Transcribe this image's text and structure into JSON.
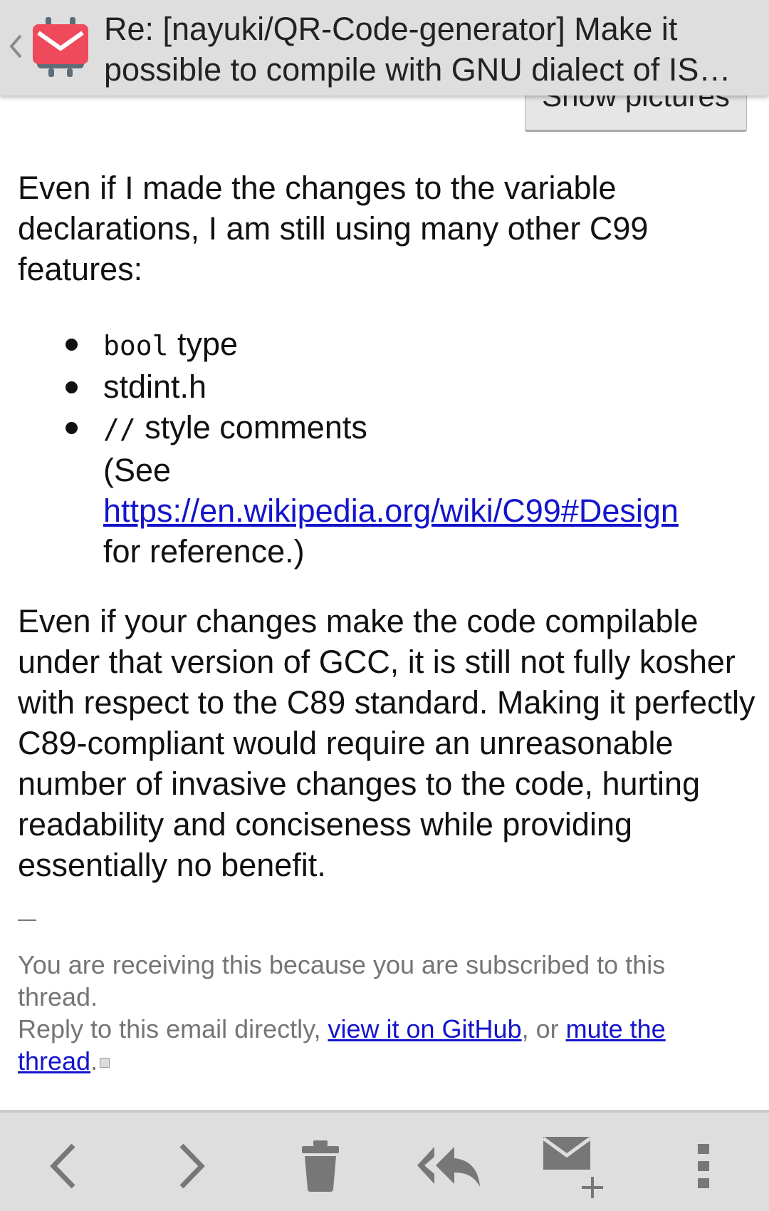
{
  "header": {
    "title": "Re: [nayuki/QR-Code-generator] Make it possible to compile with GNU dialect of IS…",
    "show_pictures_label": "Show pictures"
  },
  "body": {
    "para1": "Even if I made the changes to the variable declarations, I am still using many other C99 features:",
    "list": [
      {
        "code": "bool",
        "text": " type"
      },
      {
        "text": "stdint.h"
      },
      {
        "code": "//",
        "text": " style comments",
        "see_prefix": "(See",
        "link": "https://en.wikipedia.org/wiki/C99#Design",
        "see_suffix": "for reference.)"
      }
    ],
    "para2": "Even if your changes make the code compilable under that version of GCC, it is still not fully kosher with respect to the C89 standard. Making it perfectly C89-compliant would require an unreasonable number of invasive changes to the code, hurting readability and conciseness while providing essentially no benefit."
  },
  "footer": {
    "line1": "You are receiving this because you are subscribed to this thread.",
    "line2_prefix": "Reply to this email directly, ",
    "view_link": "view it on GitHub",
    "middle": ", or ",
    "mute_link": "mute the thread",
    "end": "."
  },
  "toolbar": {
    "icons": [
      "previous-icon",
      "next-icon",
      "trash-icon",
      "reply-all-icon",
      "compose-icon",
      "overflow-menu-icon"
    ]
  },
  "colors": {
    "bar_bg": "#dedede",
    "link": "#1414cc",
    "logo_red": "#ef4a5c",
    "icon_gray": "#777777"
  }
}
